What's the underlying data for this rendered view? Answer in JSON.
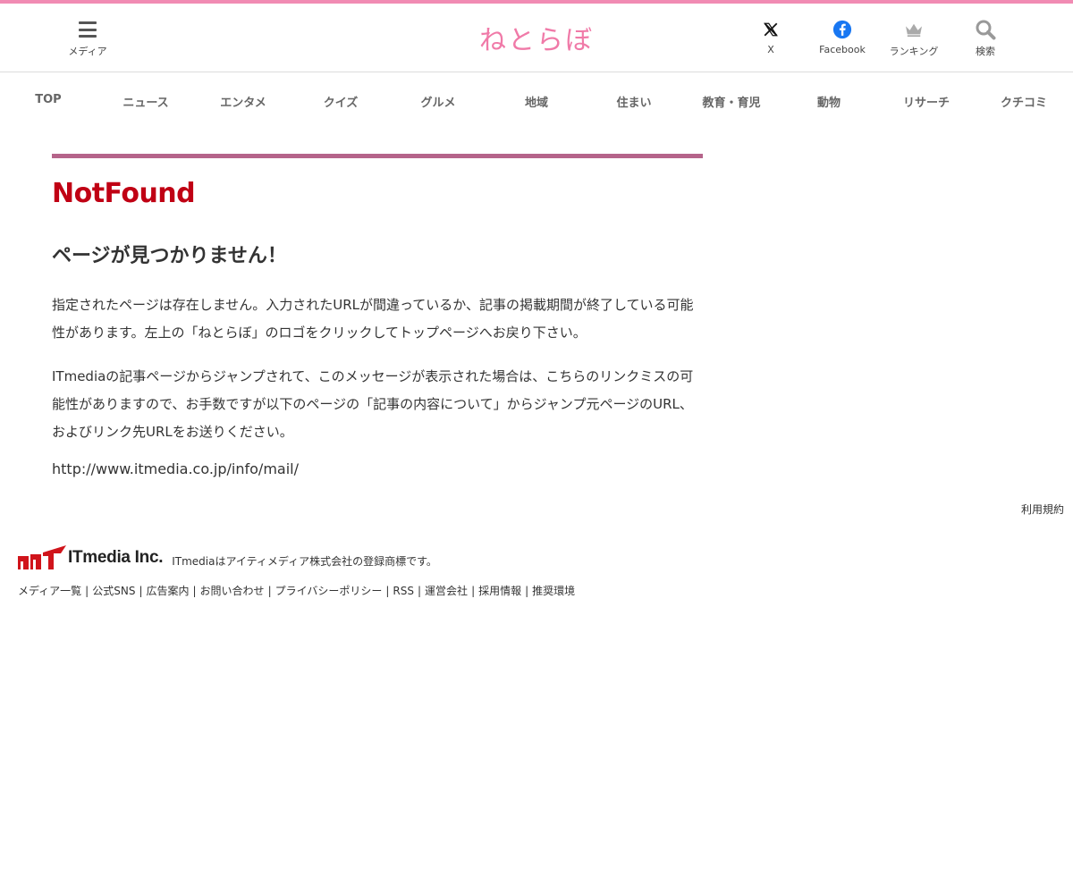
{
  "header": {
    "menu_label": "メディア",
    "logo_text": "ねとらぼ",
    "x_label": "X",
    "facebook_label": "Facebook",
    "ranking_label": "ランキング",
    "search_label": "検索",
    "accent_color": "#f18bb3",
    "facebook_color": "#1877f2"
  },
  "nav": {
    "items": [
      {
        "label": "TOP"
      },
      {
        "label": "ニュース"
      },
      {
        "label": "エンタメ"
      },
      {
        "label": "クイズ"
      },
      {
        "label": "グルメ"
      },
      {
        "label": "地域"
      },
      {
        "label": "住まい"
      },
      {
        "label": "教育・育児"
      },
      {
        "label": "動物"
      },
      {
        "label": "リサーチ"
      },
      {
        "label": "クチコミ"
      }
    ]
  },
  "main": {
    "title": "NotFound",
    "subtitle": "ページが見つかりません！",
    "paragraph1": "指定されたページは存在しません。入力されたURLが間違っているか、記事の掲載期間が終了している可能性があります。左上の「ねとらぼ」のロゴをクリックしてトップページへお戻り下さい。",
    "paragraph2": "ITmediaの記事ページからジャンプされて、このメッセージが表示された場合は、こちらのリンクミスの可能性がありますので、お手数ですが以下のページの「記事の内容について」からジャンプ元ページのURL、およびリンク先URLをお送りください。",
    "url": "http://www.itmedia.co.jp/info/mail/"
  },
  "footer": {
    "terms": "利用規約",
    "company_name": "ITmedia Inc.",
    "trademark_note": "ITmediaはアイティメディア株式会社の登録商標です。",
    "links": [
      "メディア一覧",
      "公式SNS",
      "広告案内",
      "お問い合わせ",
      "プライバシーポリシー",
      "RSS",
      "運営会社",
      "採用情報",
      "推奨環境"
    ],
    "separator": "|"
  }
}
